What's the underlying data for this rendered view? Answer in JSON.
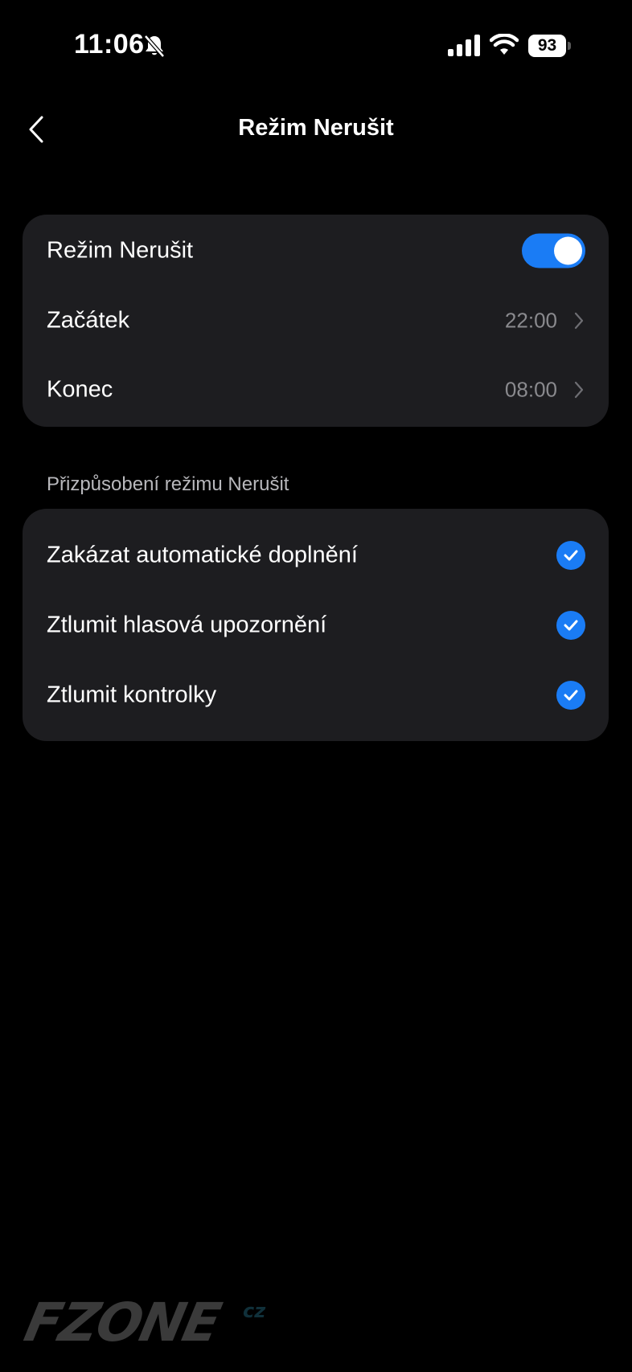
{
  "status_bar": {
    "time": "11:06",
    "battery_level": "93",
    "icons": [
      "bell-muted-icon",
      "signal-icon",
      "wifi-icon",
      "battery-icon"
    ]
  },
  "header": {
    "back_icon": "chevron-left-icon",
    "title": "Režim Nerušit"
  },
  "main_card": {
    "dnd_toggle": {
      "label": "Režim Nerušit",
      "enabled": true
    },
    "start": {
      "label": "Začátek",
      "value": "22:00"
    },
    "end": {
      "label": "Konec",
      "value": "08:00"
    }
  },
  "custom_section": {
    "header": "Přizpůsobení režimu Nerušit",
    "items": [
      {
        "label": "Zakázat automatické doplnění",
        "checked": true
      },
      {
        "label": "Ztlumit hlasová upozornění",
        "checked": true
      },
      {
        "label": "Ztlumit kontrolky",
        "checked": true
      }
    ]
  },
  "watermark": {
    "brand": "FZONE",
    "suffix": "cz"
  },
  "colors": {
    "background": "#000000",
    "card": "#1d1d20",
    "accent": "#1a7cf5",
    "secondary_text": "#8a8a8e"
  }
}
